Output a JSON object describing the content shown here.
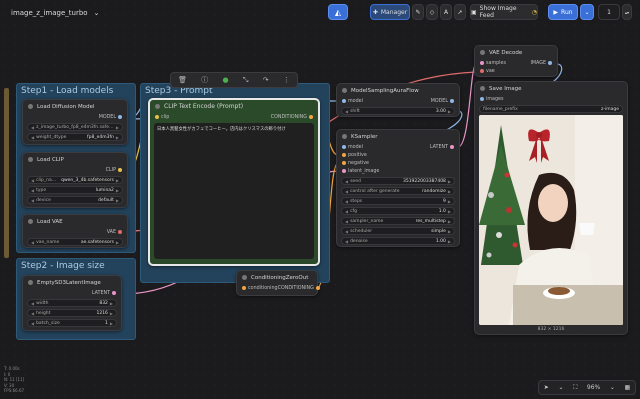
{
  "workflow": {
    "title": "image_z_image_turbo"
  },
  "topbar": {
    "manager": "Manager",
    "show_image_feed": "Show Image Feed",
    "run": "Run",
    "batch_count": "1",
    "accent": "#3b6fd8"
  },
  "groups": {
    "step1": "Step1 - Load models",
    "step2": "Step2 - Image size",
    "step3": "Step3 - Prompt"
  },
  "load_diffusion": {
    "title": "Load Diffusion Model",
    "out": "MODEL",
    "unet_name": "z_image_turbo_fp8_e4m3fn.safe...",
    "weight_dtype_label": "weight_dtype",
    "weight_dtype": "fp8_e4m3fn"
  },
  "load_clip": {
    "title": "Load CLIP",
    "out": "CLIP",
    "clip_name_label": "clip_na...",
    "clip_name": "qwen_3_4b.safetensors",
    "type_label": "type",
    "type": "lumina2",
    "device_label": "device",
    "device": "default"
  },
  "load_vae": {
    "title": "Load VAE",
    "out": "VAE",
    "vae_name_label": "vae_name",
    "vae_name": "ae.safetensors"
  },
  "latent": {
    "title": "EmptySD3LatentImage",
    "out": "LATENT",
    "width_label": "width",
    "width": "832",
    "height_label": "height",
    "height": "1216",
    "batch_label": "batch_size",
    "batch": "1"
  },
  "clip_encode": {
    "title": "CLIP Text Encode (Prompt)",
    "in": "clip",
    "out": "CONDITIONING",
    "text": "日本人黒髪女性がカフェでコーヒー。店内はクリスマスの飾り付け"
  },
  "cond_zero": {
    "title": "ConditioningZeroOut",
    "in": "conditioning",
    "out": "CONDITIONING"
  },
  "model_sampling": {
    "title": "ModelSamplingAuraFlow",
    "in": "model",
    "out": "MODEL",
    "shift_label": "shift",
    "shift": "3.00"
  },
  "ksampler": {
    "title": "KSampler",
    "inputs": [
      "model",
      "positive",
      "negative",
      "latent_image"
    ],
    "out": "LATENT",
    "widgets": [
      {
        "label": "seed",
        "value": "351922003387408"
      },
      {
        "label": "control after generate",
        "value": "randomize"
      },
      {
        "label": "steps",
        "value": "9"
      },
      {
        "label": "cfg",
        "value": "1.0"
      },
      {
        "label": "sampler_name",
        "value": "res_multistep"
      },
      {
        "label": "scheduler",
        "value": "simple"
      },
      {
        "label": "denoise",
        "value": "1.00"
      }
    ]
  },
  "vae_decode": {
    "title": "VAE Decode",
    "in1": "samples",
    "in2": "vae",
    "out": "IMAGE"
  },
  "save_image": {
    "title": "Save Image",
    "in": "images",
    "prefix_label": "filename_prefix",
    "prefix": "z-image",
    "size": "832 × 1216"
  },
  "stats": [
    "T: 0.00s",
    "I: 0",
    "N: 11 [11]",
    "V: 30",
    "FPS:66.67"
  ],
  "zoom": "96%"
}
